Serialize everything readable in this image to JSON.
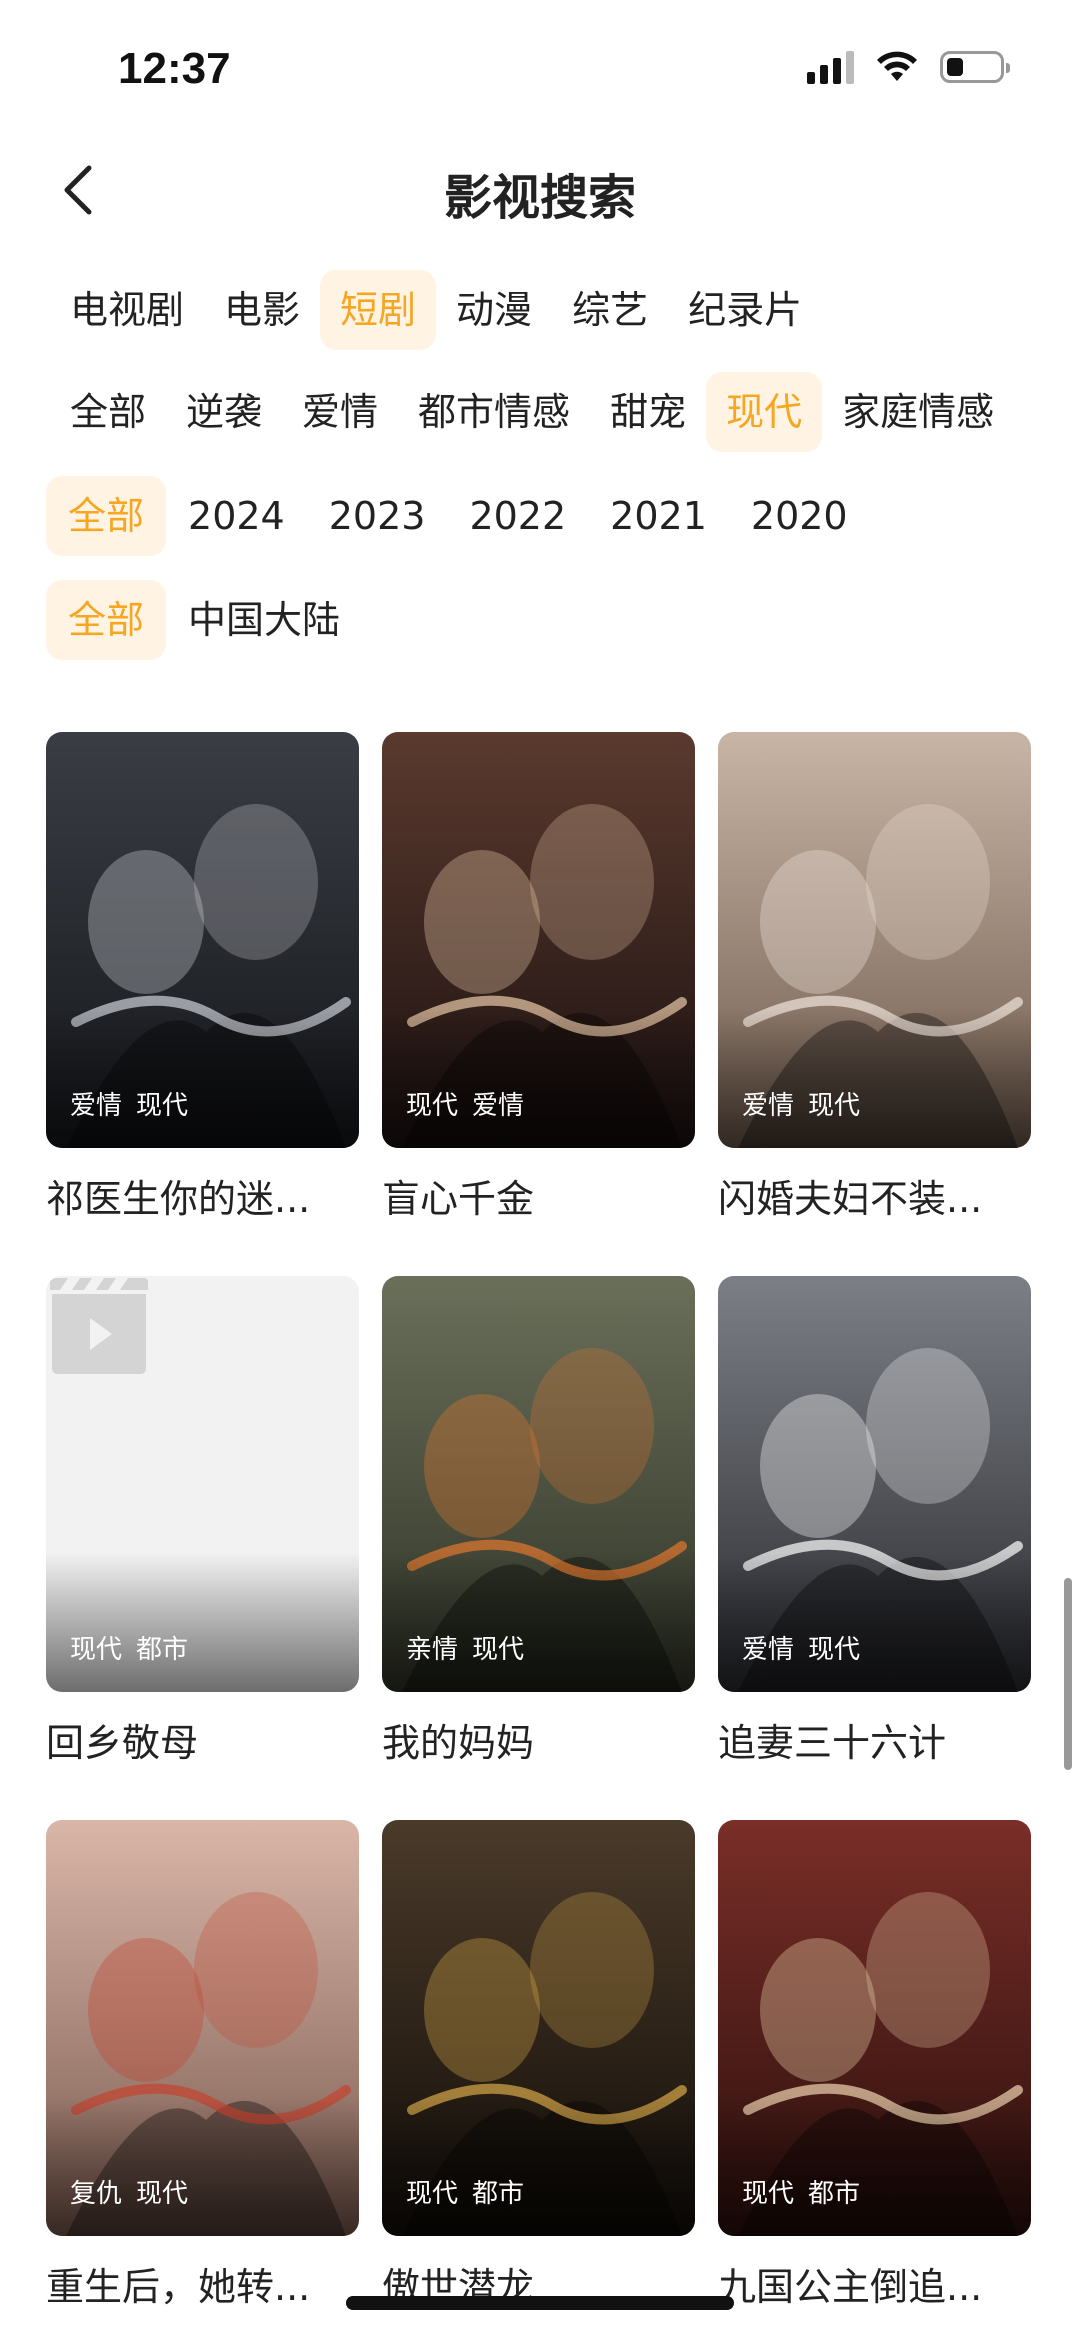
{
  "status": {
    "time": "12:37"
  },
  "header": {
    "title": "影视搜索"
  },
  "filters": {
    "types": [
      {
        "label": "电视剧",
        "active": false
      },
      {
        "label": "电影",
        "active": false
      },
      {
        "label": "短剧",
        "active": true
      },
      {
        "label": "动漫",
        "active": false
      },
      {
        "label": "综艺",
        "active": false
      },
      {
        "label": "纪录片",
        "active": false
      }
    ],
    "genres": [
      {
        "label": "全部",
        "active": false
      },
      {
        "label": "逆袭",
        "active": false
      },
      {
        "label": "爱情",
        "active": false
      },
      {
        "label": "都市情感",
        "active": false
      },
      {
        "label": "甜宠",
        "active": false
      },
      {
        "label": "现代",
        "active": true
      },
      {
        "label": "家庭情感",
        "active": false
      }
    ],
    "years": [
      {
        "label": "全部",
        "active": true
      },
      {
        "label": "2024",
        "active": false
      },
      {
        "label": "2023",
        "active": false
      },
      {
        "label": "2022",
        "active": false
      },
      {
        "label": "2021",
        "active": false
      },
      {
        "label": "2020",
        "active": false
      }
    ],
    "regions": [
      {
        "label": "全部",
        "active": true
      },
      {
        "label": "中国大陆",
        "active": false
      }
    ]
  },
  "items": [
    {
      "title": "祁医生你的迷...",
      "tags": [
        "爱情",
        "现代"
      ],
      "poster": {
        "bg1": "#3a3d44",
        "bg2": "#15171b",
        "accent": "#cfd2d8"
      }
    },
    {
      "title": "盲心千金",
      "tags": [
        "现代",
        "爱情"
      ],
      "poster": {
        "bg1": "#5a3a2e",
        "bg2": "#1b1010",
        "accent": "#e9c9a8"
      }
    },
    {
      "title": "闪婚夫妇不装...",
      "tags": [
        "爱情",
        "现代"
      ],
      "poster": {
        "bg1": "#c9b5a6",
        "bg2": "#6e5a4c",
        "accent": "#f1e6dc"
      }
    },
    {
      "title": "回乡敬母",
      "tags": [
        "现代",
        "都市"
      ],
      "poster": {
        "placeholder": true
      }
    },
    {
      "title": "我的妈妈",
      "tags": [
        "亲情",
        "现代"
      ],
      "poster": {
        "bg1": "#6a6f5a",
        "bg2": "#2f3326",
        "accent": "#e2772d"
      }
    },
    {
      "title": "追妻三十六计",
      "tags": [
        "爱情",
        "现代"
      ],
      "poster": {
        "bg1": "#7c7f86",
        "bg2": "#2a2b30",
        "accent": "#ffffff"
      }
    },
    {
      "title": "重生后，她转...",
      "tags": [
        "复仇",
        "现代"
      ],
      "poster": {
        "bg1": "#d9b6a8",
        "bg2": "#7a5a4f",
        "accent": "#c4432f"
      }
    },
    {
      "title": "傲世潜龙",
      "tags": [
        "现代",
        "都市"
      ],
      "poster": {
        "bg1": "#4a3a2a",
        "bg2": "#120d08",
        "accent": "#d8a94a"
      }
    },
    {
      "title": "九国公主倒追...",
      "tags": [
        "现代",
        "都市"
      ],
      "poster": {
        "bg1": "#7a2e28",
        "bg2": "#2a0f0c",
        "accent": "#f1d6b0"
      }
    }
  ]
}
